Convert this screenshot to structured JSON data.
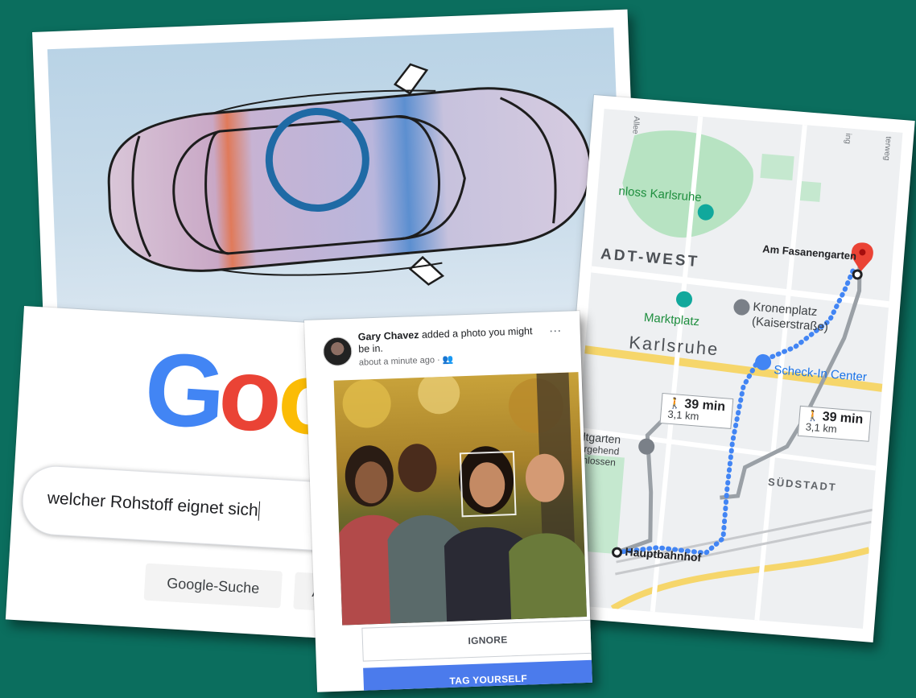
{
  "google": {
    "logo_letters": [
      {
        "char": "G",
        "color": "#4285F4"
      },
      {
        "char": "o",
        "color": "#EA4335"
      },
      {
        "char": "o",
        "color": "#FBBC05"
      }
    ],
    "search_value": "welcher Rohstoff eignet sich",
    "search_button": "Google-Suche",
    "lucky_button_partial": "Au"
  },
  "facebook": {
    "user_name": "Gary Chavez",
    "notification_text": "added a photo you might be in.",
    "meta_text": "about a minute ago",
    "more_icon": "…",
    "ignore_label": "IGNORE",
    "tag_label": "TAG YOURSELF",
    "accent_color": "#4b7bec"
  },
  "map": {
    "labels": {
      "schloss": "nloss Karlsruhe",
      "west": "ADT-WEST",
      "destination": "Am Fasanengarten",
      "kronenplatz": "Kronenplatz",
      "kaiserstrasse": "(Kaiserstraße)",
      "marktplatz": "Marktplatz",
      "karlsruhe": "Karlsruhe",
      "scheck_in": "Scheck-In Center",
      "garten": "dtgarten",
      "ergehend": "ergehend",
      "schlossen": "chlossen",
      "suedstadt": "SÜDSTADT",
      "hauptbahnhof": "Hauptbahnhof",
      "allee": "Allee",
      "ring": "ing",
      "weg": "terweg"
    },
    "routes": [
      {
        "time": "39 min",
        "distance": "3,1 km"
      },
      {
        "time": "39 min",
        "distance": "3,1 km"
      }
    ]
  }
}
